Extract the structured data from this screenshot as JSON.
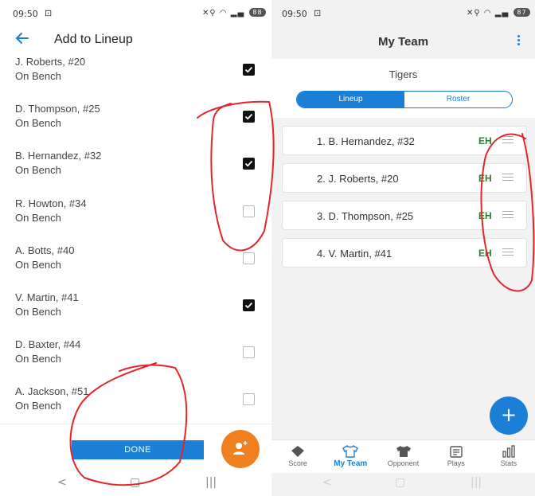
{
  "left": {
    "status": {
      "time": "09:50",
      "battery": "88"
    },
    "header": {
      "title": "Add to Lineup"
    },
    "players": [
      {
        "name": "J. Roberts, #20",
        "status": "On Bench",
        "checked": true
      },
      {
        "name": "D. Thompson, #25",
        "status": "On Bench",
        "checked": true
      },
      {
        "name": "B. Hernandez, #32",
        "status": "On Bench",
        "checked": true
      },
      {
        "name": "R. Howton, #34",
        "status": "On Bench",
        "checked": false
      },
      {
        "name": "A. Botts, #40",
        "status": "On Bench",
        "checked": false
      },
      {
        "name": "V. Martin, #41",
        "status": "On Bench",
        "checked": true
      },
      {
        "name": "D. Baxter, #44",
        "status": "On Bench",
        "checked": false
      },
      {
        "name": "A. Jackson, #51",
        "status": "On Bench",
        "checked": false
      }
    ],
    "footer": {
      "done_label": "DONE"
    }
  },
  "right": {
    "status": {
      "time": "09:50",
      "battery": "87"
    },
    "header": {
      "title": "My Team"
    },
    "team_name": "Tigers",
    "segments": {
      "lineup": "Lineup",
      "roster": "Roster"
    },
    "lineup": [
      {
        "label": "1. B. Hernandez, #32",
        "position": "EH"
      },
      {
        "label": "2. J. Roberts, #20",
        "position": "EH"
      },
      {
        "label": "3. D. Thompson, #25",
        "position": "EH"
      },
      {
        "label": "4. V. Martin, #41",
        "position": "EH"
      }
    ],
    "fab_label": "+",
    "tabs": [
      {
        "label": "Score",
        "icon": "diamond-icon"
      },
      {
        "label": "My Team",
        "icon": "jersey-icon",
        "active": true
      },
      {
        "label": "Opponent",
        "icon": "jersey-filled-icon"
      },
      {
        "label": "Plays",
        "icon": "clipboard-icon"
      },
      {
        "label": "Stats",
        "icon": "bar-chart-icon"
      }
    ]
  },
  "colors": {
    "accent": "#1c7fd6",
    "fab_orange": "#f07f1f",
    "position_green": "#2e7d32",
    "annotation_red": "#e3262b"
  }
}
